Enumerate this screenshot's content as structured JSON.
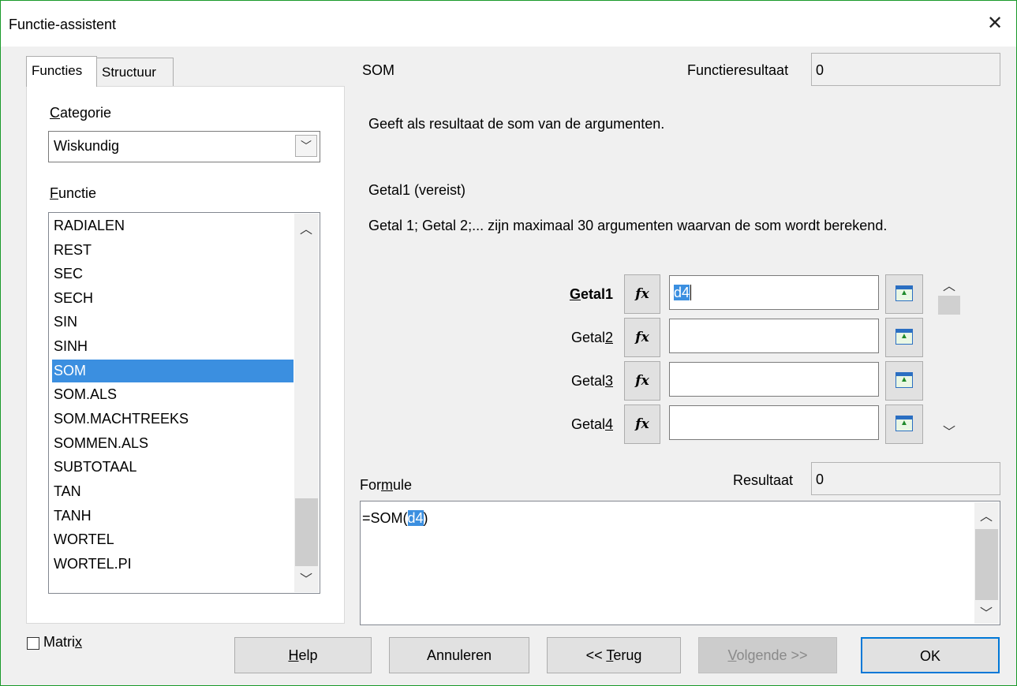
{
  "window": {
    "title": "Functie-assistent",
    "close_glyph": "✕"
  },
  "tabs": [
    {
      "label": "Functies",
      "active": true
    },
    {
      "label": "Structuur",
      "active": false
    }
  ],
  "category": {
    "label_underlined": "C",
    "label_rest": "ategorie",
    "value": "Wiskundig"
  },
  "function_list": {
    "label_underlined": "F",
    "label_rest": "unctie",
    "items": [
      "RADIALEN",
      "REST",
      "SEC",
      "SECH",
      "SIN",
      "SINH",
      "SOM",
      "SOM.ALS",
      "SOM.MACHTREEKS",
      "SOMMEN.ALS",
      "SUBTOTAAL",
      "TAN",
      "TANH",
      "WORTEL",
      "WORTEL.PI"
    ],
    "selected": "SOM"
  },
  "matrix": {
    "label_main": "Matri",
    "label_underlined": "x",
    "checked": false
  },
  "function_info": {
    "name": "SOM",
    "result_label": "Functieresultaat",
    "result_value": "0",
    "description": "Geeft als resultaat de som van de argumenten.",
    "argument_name": "Getal1 (vereist)",
    "argument_description": "Getal 1; Getal 2;... zijn maximaal 30 argumenten waarvan de som wordt berekend."
  },
  "arguments": [
    {
      "pre": "",
      "u": "G",
      "post": "etal1",
      "value": "d4",
      "bold": true
    },
    {
      "pre": "Getal",
      "u": "2",
      "post": "",
      "value": ""
    },
    {
      "pre": "Getal",
      "u": "3",
      "post": "",
      "value": ""
    },
    {
      "pre": "Getal",
      "u": "4",
      "post": "",
      "value": ""
    }
  ],
  "fx_label": "fx",
  "formula": {
    "label_pre": "For",
    "label_u": "m",
    "label_post": "ule",
    "result_label": "Resultaat",
    "result_value": "0",
    "text_before": "=SOM(",
    "text_highlight": "d4",
    "text_after": ")"
  },
  "buttons": {
    "help_u": "H",
    "help_rest": "elp",
    "cancel": "Annuleren",
    "back_pre": "<< ",
    "back_u": "T",
    "back_rest": "erug",
    "next_u": "V",
    "next_rest": "olgende >>",
    "ok": "OK"
  },
  "colors": {
    "selection": "#3b8fe0",
    "default_button_border": "#0078d7",
    "window_border": "#1a9a2a"
  }
}
